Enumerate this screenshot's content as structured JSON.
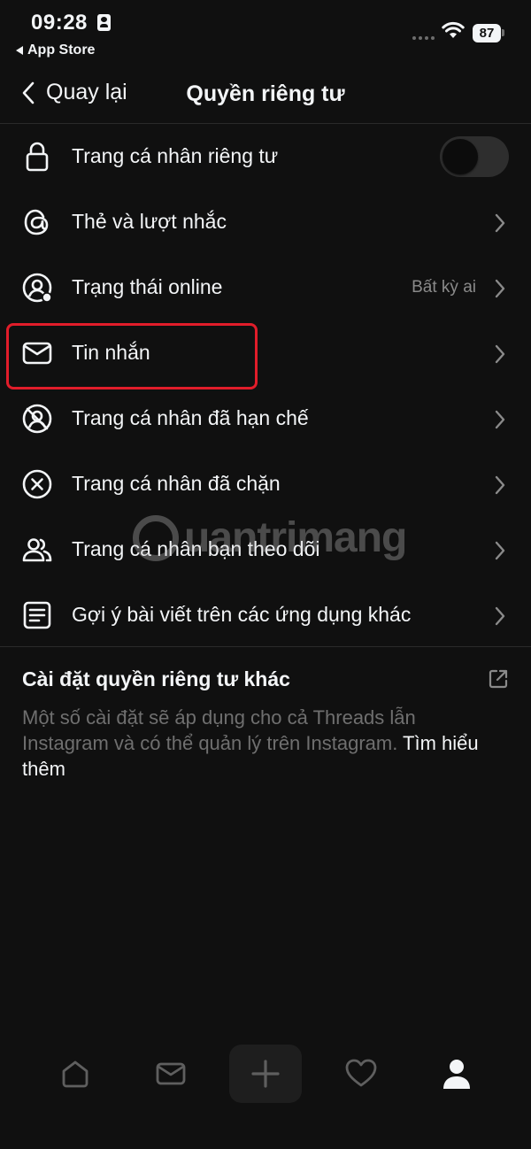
{
  "status_bar": {
    "time": "09:28",
    "back_app": "App Store",
    "battery": "87"
  },
  "nav": {
    "back_label": "Quay lại",
    "title": "Quyền riêng tư"
  },
  "settings": [
    {
      "label": "Trang cá nhân riêng tư",
      "icon": "lock-icon",
      "control": "toggle",
      "toggle_on": false
    },
    {
      "label": "Thẻ và lượt nhắc",
      "icon": "threads-at-icon",
      "control": "chevron"
    },
    {
      "label": "Trạng thái online",
      "icon": "online-status-icon",
      "control": "chevron",
      "value": "Bất kỳ ai"
    },
    {
      "label": "Tin nhắn",
      "icon": "mail-icon",
      "control": "chevron",
      "highlighted": true
    },
    {
      "label": "Trang cá nhân đã hạn chế",
      "icon": "restricted-profile-icon",
      "control": "chevron"
    },
    {
      "label": "Trang cá nhân đã chặn",
      "icon": "blocked-icon",
      "control": "chevron"
    },
    {
      "label": "Trang cá nhân bạn theo dõi",
      "icon": "people-icon",
      "control": "chevron"
    },
    {
      "label": "Gợi ý bài viết trên các ứng dụng khác",
      "icon": "document-icon",
      "control": "chevron"
    }
  ],
  "other_privacy": {
    "title": "Cài đặt quyền riêng tư khác",
    "description": "Một số cài đặt sẽ áp dụng cho cả Threads lẫn Instagram và có thể quản lý trên Instagram.",
    "link": "Tìm hiểu thêm",
    "icon": "external-link-icon"
  },
  "watermark": "uantrimang",
  "tabbar": [
    "home-icon",
    "inbox-icon",
    "compose-icon",
    "heart-icon",
    "profile-icon"
  ],
  "colors": {
    "background": "#101010",
    "text": "#f3f5f7",
    "muted": "#6f6f6f",
    "highlight": "#e11d2a"
  }
}
